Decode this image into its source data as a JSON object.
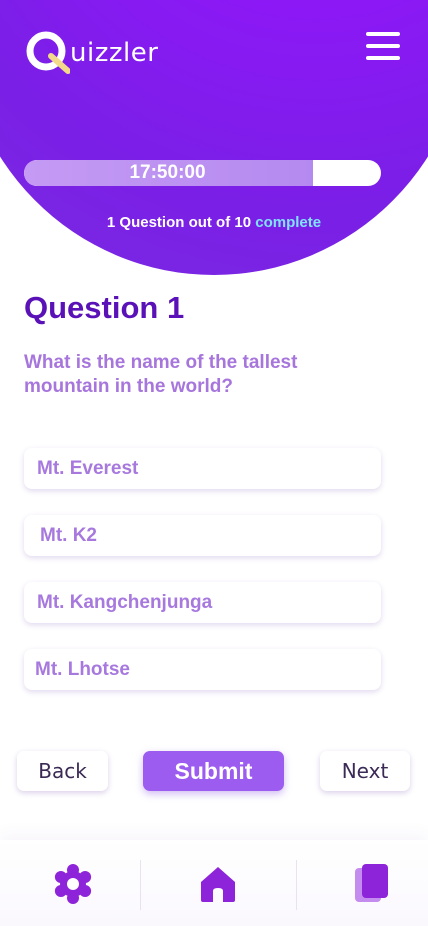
{
  "app": {
    "logo_letter": "Q",
    "logo_rest": "uizzler"
  },
  "colors": {
    "brand_purple": "#8c18f6",
    "title_purple": "#5a12b8",
    "option_text": "#a779de",
    "accent_complete": "#7fe3ff",
    "submit_bg": "#9d5cf0"
  },
  "timer": {
    "label": "17:50:00",
    "progress_fraction": 0.81
  },
  "status": {
    "prefix": "1 Question out of 10",
    "suffix": "complete"
  },
  "question": {
    "title": "Question 1",
    "text": "What is the name of the tallest mountain in the world?"
  },
  "options": [
    {
      "label": "Mt. Everest"
    },
    {
      "label": "Mt. K2"
    },
    {
      "label": "Mt. Kangchenjunga"
    },
    {
      "label": "Mt. Lhotse"
    }
  ],
  "actions": {
    "back": "Back",
    "submit": "Submit",
    "next": "Next"
  },
  "nav": {
    "items": [
      {
        "icon": "gear-icon"
      },
      {
        "icon": "home-icon"
      },
      {
        "icon": "cards-icon"
      }
    ]
  }
}
